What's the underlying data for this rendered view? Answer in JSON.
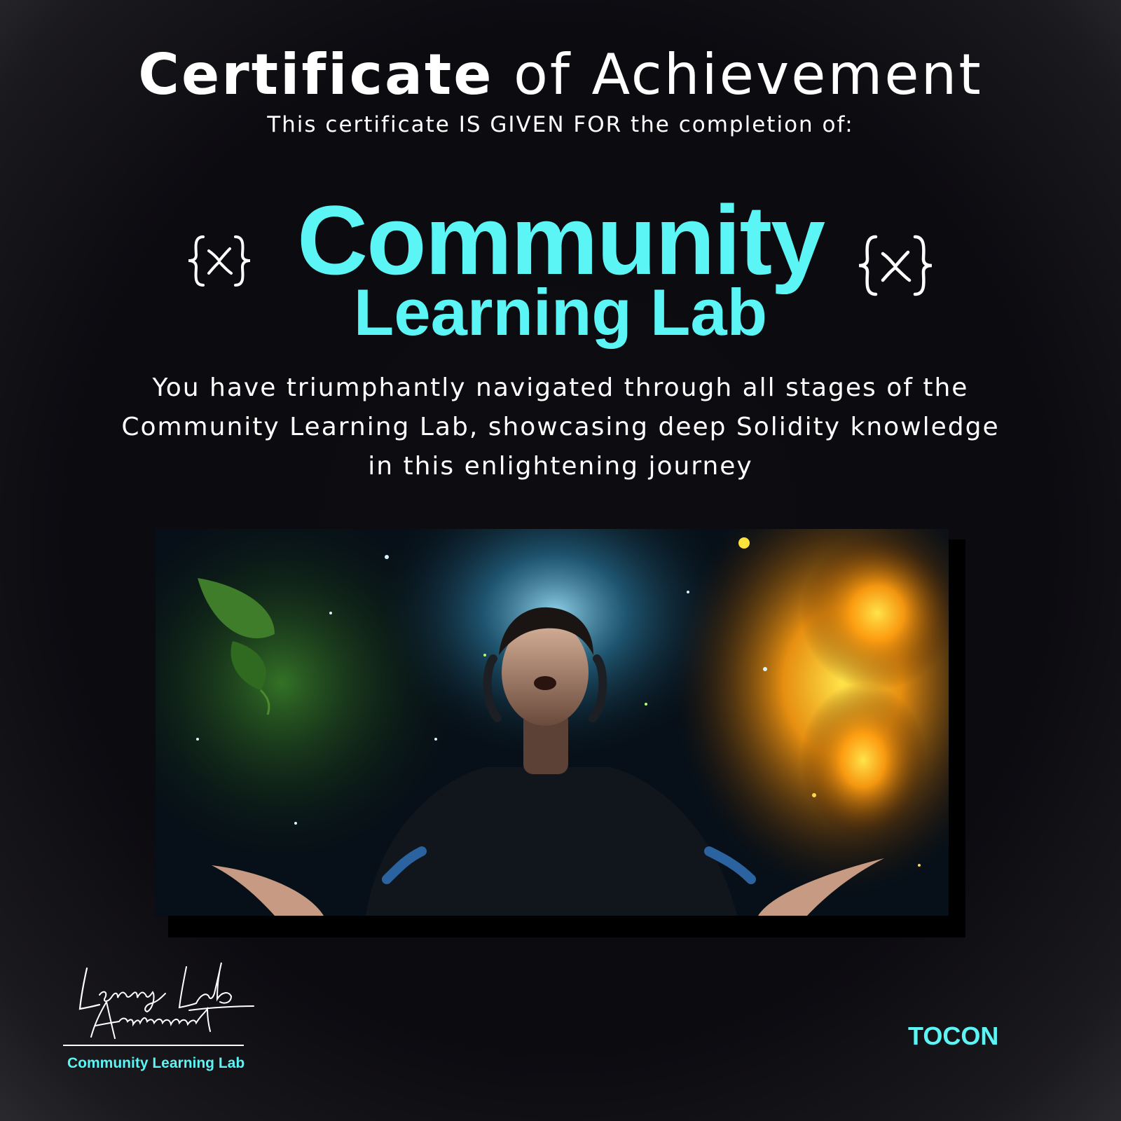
{
  "certificate": {
    "title_strong": "Certificate",
    "title_rest": "of Achievement",
    "subtitle": "This certificate IS GIVEN FOR the completion of:",
    "program_line1": "Community",
    "program_line2": "Learning Lab",
    "description": "You have triumphantly navigated through all stages of the Community Learning Lab, showcasing deep Solidity knowledge in this enlightening journey"
  },
  "decor": {
    "left_icon": "x-brace-icon",
    "right_icon": "x-brace-icon",
    "hero_image": "explorer-in-glowing-forest-illustration"
  },
  "footer": {
    "signature_text": "Learning Lab Achievement",
    "signature_caption": "Community Learning Lab",
    "issuer": "TOCON"
  },
  "colors": {
    "background": "#0c0b10",
    "accent": "#5cf5f6",
    "text": "#ffffff"
  }
}
